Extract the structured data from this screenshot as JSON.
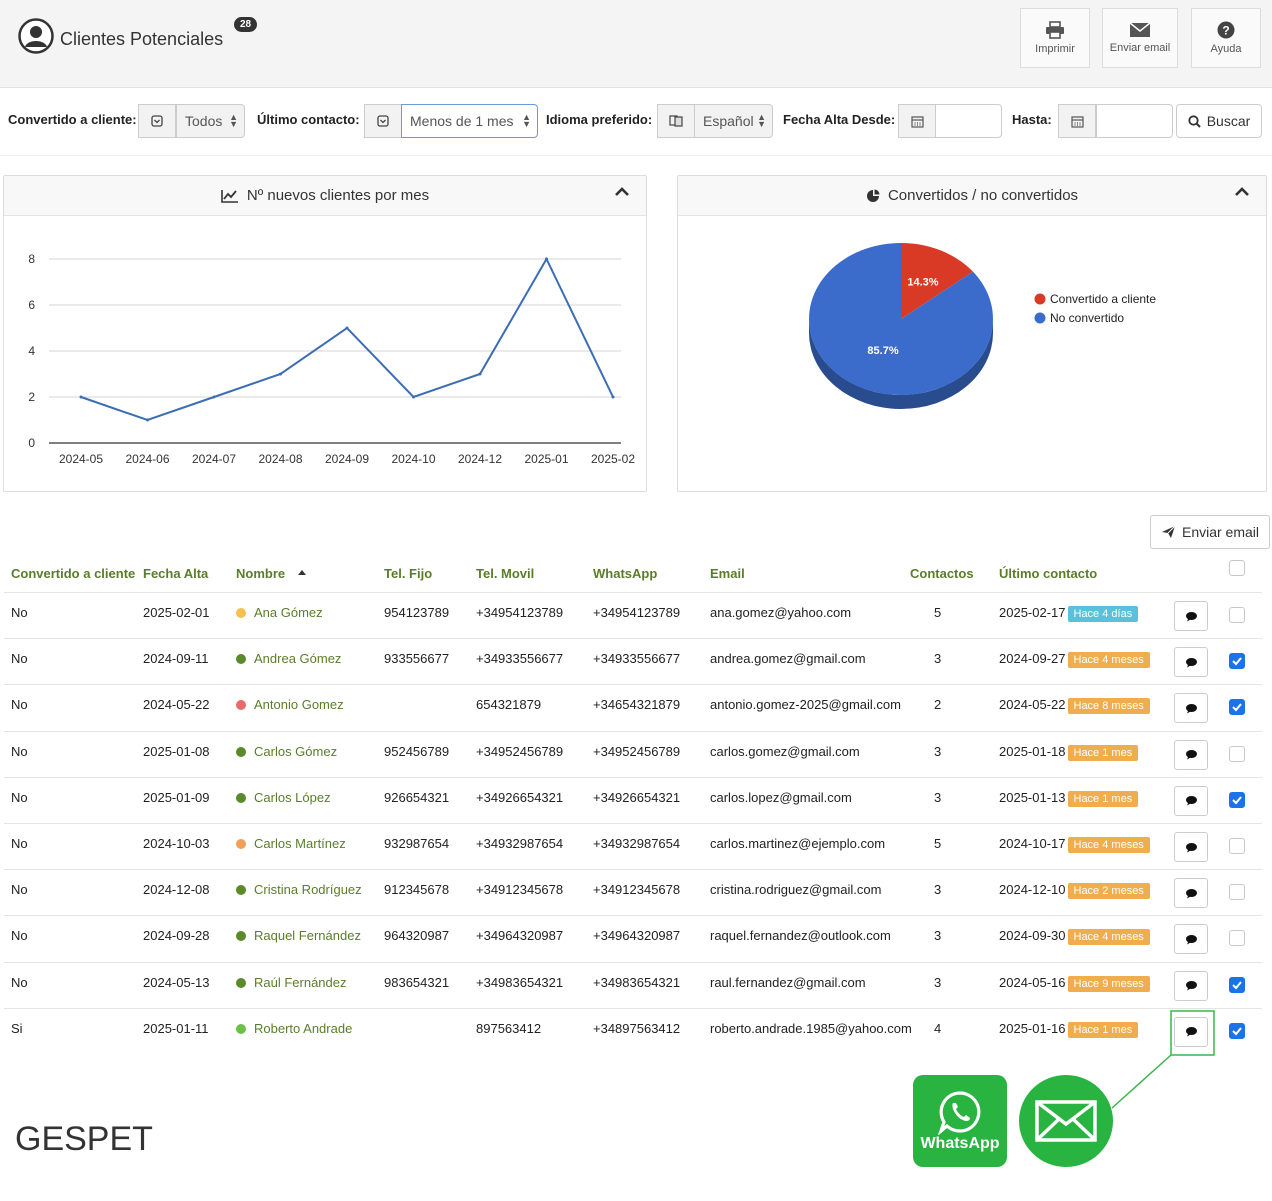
{
  "header": {
    "title": "Clientes Potenciales",
    "count": "28",
    "buttons": {
      "print": "Imprimir",
      "email": "Enviar email",
      "help": "Ayuda"
    }
  },
  "filters": {
    "converted_label": "Convertido a cliente:",
    "converted_value": "Todos",
    "last_contact_label": "Último contacto:",
    "last_contact_value": "Menos de 1 mes",
    "language_label": "Idioma preferido:",
    "language_value": "Español",
    "date_from_label": "Fecha Alta Desde:",
    "date_to_label": "Hasta:",
    "search_label": "Buscar"
  },
  "line_panel": {
    "title": "Nº nuevos clientes por mes"
  },
  "pie_panel": {
    "title": "Convertidos / no convertidos"
  },
  "chart_data": [
    {
      "type": "line",
      "title": "Nº nuevos clientes por mes",
      "categories": [
        "2024-05",
        "2024-06",
        "2024-07",
        "2024-08",
        "2024-09",
        "2024-10",
        "2024-12",
        "2025-01",
        "2025-02"
      ],
      "values": [
        2,
        1,
        2,
        3,
        5,
        2,
        3,
        8,
        2
      ],
      "yticks": [
        "0",
        "2",
        "4",
        "6",
        "8"
      ],
      "ylim": [
        0,
        8
      ],
      "grid": true,
      "color": "#3b6db3"
    },
    {
      "type": "pie",
      "title": "Convertidos / no convertidos",
      "slices": [
        {
          "label": "Convertido a cliente",
          "value": 14.3,
          "display": "14.3%",
          "color": "#d93a26"
        },
        {
          "label": "No convertido",
          "value": 85.7,
          "display": "85.7%",
          "color": "#3b6ccc"
        }
      ],
      "legend": "right"
    }
  ],
  "actions": {
    "send_email": "Enviar email"
  },
  "table": {
    "columns": [
      "Convertido a cliente",
      "Fecha Alta",
      "Nombre",
      "Tel. Fijo",
      "Tel. Movil",
      "WhatsApp",
      "Email",
      "Contactos",
      "Último contacto"
    ],
    "rows": [
      {
        "conv": "No",
        "fecha": "2025-02-01",
        "nombre": "Ana Gómez",
        "dot": "#f2c14e",
        "fijo": "954123789",
        "movil": "+34954123789",
        "wa": "+34954123789",
        "email": "ana.gomez@yahoo.com",
        "contactos": "5",
        "ultimo": "2025-02-17",
        "hace": "Hace 4 días",
        "hace_color": "#5bc0de",
        "checked": false
      },
      {
        "conv": "No",
        "fecha": "2024-09-11",
        "nombre": "Andrea Gómez",
        "dot": "#5a8a2a",
        "fijo": "933556677",
        "movil": "+34933556677",
        "wa": "+34933556677",
        "email": "andrea.gomez@gmail.com",
        "contactos": "3",
        "ultimo": "2024-09-27",
        "hace": "Hace 4 meses",
        "hace_color": "#f0ad4e",
        "checked": true
      },
      {
        "conv": "No",
        "fecha": "2024-05-22",
        "nombre": "Antonio Gomez",
        "dot": "#e86a6a",
        "fijo": "",
        "movil": "654321879",
        "wa": "+34654321879",
        "email": "antonio.gomez-2025@gmail.com",
        "contactos": "2",
        "ultimo": "2024-05-22",
        "hace": "Hace 8 meses",
        "hace_color": "#f0ad4e",
        "checked": true
      },
      {
        "conv": "No",
        "fecha": "2025-01-08",
        "nombre": "Carlos Gómez",
        "dot": "#5a8a2a",
        "fijo": "952456789",
        "movil": "+34952456789",
        "wa": "+34952456789",
        "email": "carlos.gomez@gmail.com",
        "contactos": "3",
        "ultimo": "2025-01-18",
        "hace": "Hace 1 mes",
        "hace_color": "#f0ad4e",
        "checked": false
      },
      {
        "conv": "No",
        "fecha": "2025-01-09",
        "nombre": "Carlos López",
        "dot": "#5a8a2a",
        "fijo": "926654321",
        "movil": "+34926654321",
        "wa": "+34926654321",
        "email": "carlos.lopez@gmail.com",
        "contactos": "3",
        "ultimo": "2025-01-13",
        "hace": "Hace 1 mes",
        "hace_color": "#f0ad4e",
        "checked": true
      },
      {
        "conv": "No",
        "fecha": "2024-10-03",
        "nombre": "Carlos Martínez",
        "dot": "#f0a05a",
        "fijo": "932987654",
        "movil": "+34932987654",
        "wa": "+34932987654",
        "email": "carlos.martinez@ejemplo.com",
        "contactos": "5",
        "ultimo": "2024-10-17",
        "hace": "Hace 4 meses",
        "hace_color": "#f0ad4e",
        "checked": false
      },
      {
        "conv": "No",
        "fecha": "2024-12-08",
        "nombre": "Cristina Rodríguez",
        "dot": "#5a8a2a",
        "fijo": "912345678",
        "movil": "+34912345678",
        "wa": "+34912345678",
        "email": "cristina.rodriguez@gmail.com",
        "contactos": "3",
        "ultimo": "2024-12-10",
        "hace": "Hace 2 meses",
        "hace_color": "#f0ad4e",
        "checked": false
      },
      {
        "conv": "No",
        "fecha": "2024-09-28",
        "nombre": "Raquel Fernández",
        "dot": "#5a8a2a",
        "fijo": "964320987",
        "movil": "+34964320987",
        "wa": "+34964320987",
        "email": "raquel.fernandez@outlook.com",
        "contactos": "3",
        "ultimo": "2024-09-30",
        "hace": "Hace 4 meses",
        "hace_color": "#f0ad4e",
        "checked": false
      },
      {
        "conv": "No",
        "fecha": "2024-05-13",
        "nombre": "Raúl Fernández",
        "dot": "#5a8a2a",
        "fijo": "983654321",
        "movil": "+34983654321",
        "wa": "+34983654321",
        "email": "raul.fernandez@gmail.com",
        "contactos": "3",
        "ultimo": "2024-05-16",
        "hace": "Hace 9 meses",
        "hace_color": "#f0ad4e",
        "checked": true
      },
      {
        "conv": "Si",
        "fecha": "2025-01-11",
        "nombre": "Roberto Andrade",
        "dot": "#6cc04a",
        "fijo": "",
        "movil": "897563412",
        "wa": "+34897563412",
        "email": "roberto.andrade.1985@yahoo.com",
        "contactos": "4",
        "ultimo": "2025-01-16",
        "hace": "Hace 1 mes",
        "hace_color": "#f0ad4e",
        "checked": true
      }
    ]
  },
  "footer": {
    "logo": "GESPET",
    "whatsapp_label": "WhatsApp"
  }
}
